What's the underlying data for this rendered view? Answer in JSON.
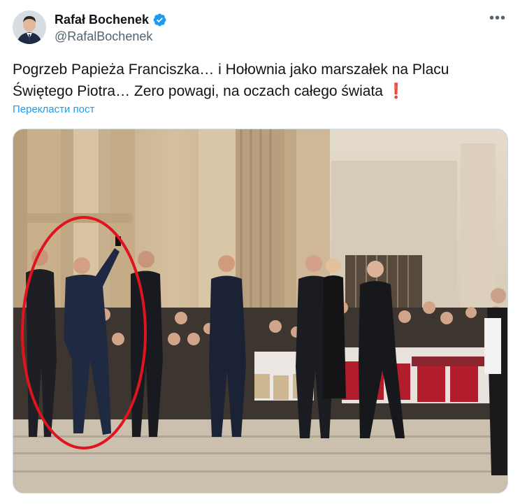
{
  "author": {
    "display_name": "Rafał Bochenek",
    "handle": "@RafalBochenek",
    "verified_icon": "verified-badge-icon"
  },
  "menu": {
    "more_label": "•••"
  },
  "tweet": {
    "text_line1": "Pogrzeb Papieża Franciszka… i Hołownia jako marszałek na Placu",
    "text_line2": "Świętego Piotra… Zero powagi, na oczach całego świata",
    "emoji": "❗",
    "translate_label": "Перекласти пост"
  },
  "media": {
    "highlight_color": "#e0141e"
  },
  "colors": {
    "link": "#1d9bf0",
    "verified": "#1d9bf0",
    "secondary_text": "#536471"
  }
}
